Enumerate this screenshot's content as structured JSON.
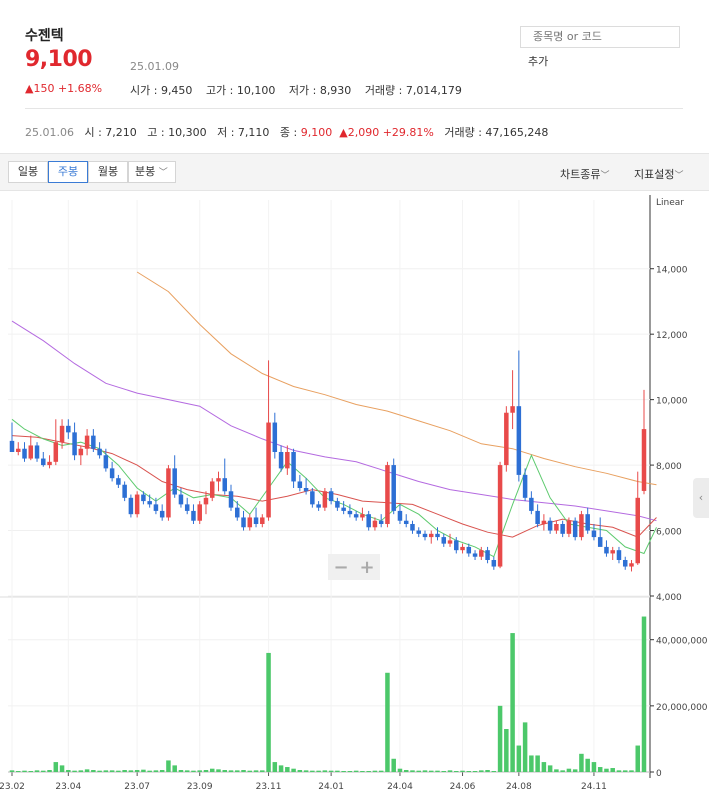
{
  "header": {
    "name": "수젠텍",
    "price": "9,100",
    "date": "25.01.09",
    "change": "▲150 +1.68%",
    "open": "시가 : 9,450",
    "high": "고가 : 10,100",
    "low": "저가 : 8,930",
    "volume": "거래량 : 7,014,179"
  },
  "search": {
    "placeholder": "종목명 or 코드",
    "add_label": "추가"
  },
  "prev": {
    "date": "25.01.06",
    "open": "시 : 7,210",
    "high": "고 : 10,300",
    "low": "저 : 7,110",
    "close_label": "종 : ",
    "close": "9,100",
    "change": "▲2,090 +29.81%",
    "volume": "거래량 : 47,165,248"
  },
  "toolbar": {
    "tabs": [
      "일봉",
      "주봉",
      "월봉",
      "분봉"
    ],
    "active": "주봉",
    "chart_type": "차트종류",
    "indicators": "지표설정"
  },
  "zoom": {
    "minus": "−",
    "plus": "+"
  },
  "colors": {
    "up": "#e84a4a",
    "down": "#2d6fd4",
    "volume": "#4cc86a",
    "ma5": "#5dca6e",
    "ma20": "#d9534f",
    "ma60": "#b46ae0",
    "ma120": "#e8a060"
  },
  "chart_data": {
    "type": "candlestick",
    "scale_label": "Linear",
    "price_ticks": [
      "14,000",
      "12,000",
      "10,000",
      "8,000",
      "6,000",
      "4,000"
    ],
    "price_tick_values": [
      14000,
      12000,
      10000,
      8000,
      6000,
      4000
    ],
    "volume_ticks": [
      "40,000,000",
      "20,000,000",
      "0"
    ],
    "volume_tick_values": [
      40000000,
      20000000,
      0
    ],
    "x_ticks": [
      "23.02",
      "23.04",
      "23.07",
      "23.09",
      "23.11",
      "24.01",
      "24.04",
      "24.06",
      "24.08",
      "24.11"
    ],
    "x_tick_index": [
      0,
      9,
      20,
      30,
      41,
      51,
      62,
      72,
      81,
      93
    ],
    "ohlc": [
      [
        8740,
        9300,
        8400,
        8400
      ],
      [
        8400,
        8700,
        8300,
        8500
      ],
      [
        8500,
        8700,
        8100,
        8200
      ],
      [
        8200,
        8900,
        8150,
        8600
      ],
      [
        8600,
        8700,
        8100,
        8200
      ],
      [
        8200,
        8400,
        7950,
        8000
      ],
      [
        8000,
        8300,
        7900,
        8100
      ],
      [
        8100,
        9400,
        8000,
        8700
      ],
      [
        8700,
        9400,
        8500,
        9200
      ],
      [
        9200,
        9400,
        8800,
        9000
      ],
      [
        9000,
        9300,
        8150,
        8300
      ],
      [
        8300,
        8600,
        8000,
        8500
      ],
      [
        8500,
        9100,
        8300,
        8900
      ],
      [
        8900,
        9100,
        8400,
        8500
      ],
      [
        8500,
        8700,
        8200,
        8300
      ],
      [
        8300,
        8500,
        7800,
        7900
      ],
      [
        7900,
        8100,
        7500,
        7600
      ],
      [
        7600,
        7700,
        7300,
        7400
      ],
      [
        7400,
        7500,
        6900,
        7000
      ],
      [
        7000,
        7100,
        6400,
        6500
      ],
      [
        6500,
        7200,
        6400,
        7100
      ],
      [
        7100,
        7200,
        6800,
        6900
      ],
      [
        6900,
        7100,
        6700,
        6800
      ],
      [
        6800,
        7000,
        6500,
        6600
      ],
      [
        6600,
        6800,
        6300,
        6400
      ],
      [
        6400,
        8000,
        6300,
        7900
      ],
      [
        7900,
        8300,
        7000,
        7100
      ],
      [
        7100,
        7300,
        6700,
        6800
      ],
      [
        6800,
        7000,
        6500,
        6600
      ],
      [
        6600,
        6800,
        6200,
        6300
      ],
      [
        6300,
        6900,
        6200,
        6800
      ],
      [
        6800,
        7200,
        6500,
        7000
      ],
      [
        7000,
        7600,
        6900,
        7500
      ],
      [
        7500,
        7800,
        7200,
        7600
      ],
      [
        7600,
        8200,
        7100,
        7200
      ],
      [
        7200,
        7400,
        6600,
        6700
      ],
      [
        6700,
        6900,
        6300,
        6400
      ],
      [
        6400,
        6600,
        6000,
        6100
      ],
      [
        6100,
        6500,
        6000,
        6400
      ],
      [
        6400,
        6700,
        6100,
        6200
      ],
      [
        6200,
        6500,
        6100,
        6400
      ],
      [
        6400,
        11200,
        6300,
        9300
      ],
      [
        9300,
        9600,
        8200,
        8400
      ],
      [
        8400,
        8600,
        7800,
        7900
      ],
      [
        7900,
        8600,
        7700,
        8400
      ],
      [
        8400,
        8500,
        7300,
        7500
      ],
      [
        7500,
        7700,
        7200,
        7300
      ],
      [
        7300,
        7600,
        7100,
        7200
      ],
      [
        7200,
        7300,
        6700,
        6800
      ],
      [
        6800,
        6900,
        6600,
        6700
      ],
      [
        6700,
        7300,
        6600,
        7200
      ],
      [
        7200,
        7300,
        6800,
        6900
      ],
      [
        6900,
        7000,
        6600,
        6700
      ],
      [
        6700,
        6900,
        6500,
        6600
      ],
      [
        6600,
        6800,
        6400,
        6500
      ],
      [
        6500,
        6600,
        6300,
        6400
      ],
      [
        6400,
        6700,
        6300,
        6500
      ],
      [
        6500,
        6600,
        6000,
        6100
      ],
      [
        6100,
        6400,
        6000,
        6300
      ],
      [
        6300,
        6500,
        6100,
        6200
      ],
      [
        6200,
        8100,
        6100,
        8000
      ],
      [
        8000,
        8200,
        6500,
        6600
      ],
      [
        6600,
        6800,
        6200,
        6300
      ],
      [
        6300,
        6500,
        6100,
        6200
      ],
      [
        6200,
        6300,
        5900,
        6000
      ],
      [
        6000,
        6100,
        5800,
        5900
      ],
      [
        5900,
        6000,
        5700,
        5800
      ],
      [
        5800,
        6000,
        5600,
        5900
      ],
      [
        5900,
        6100,
        5700,
        5800
      ],
      [
        5800,
        5900,
        5500,
        5600
      ],
      [
        5600,
        5900,
        5500,
        5700
      ],
      [
        5700,
        5800,
        5300,
        5400
      ],
      [
        5400,
        5600,
        5300,
        5500
      ],
      [
        5500,
        5600,
        5200,
        5300
      ],
      [
        5300,
        5400,
        5100,
        5200
      ],
      [
        5200,
        5500,
        5100,
        5400
      ],
      [
        5400,
        5500,
        5000,
        5100
      ],
      [
        5100,
        5200,
        4800,
        4900
      ],
      [
        4900,
        8100,
        4850,
        8000
      ],
      [
        8000,
        9800,
        7800,
        9600
      ],
      [
        9600,
        10900,
        9100,
        9800
      ],
      [
        9800,
        11500,
        7500,
        7700
      ],
      [
        7700,
        7900,
        6900,
        7000
      ],
      [
        7000,
        7200,
        6500,
        6600
      ],
      [
        6600,
        6800,
        6100,
        6200
      ],
      [
        6200,
        6500,
        6000,
        6300
      ],
      [
        6300,
        6400,
        5900,
        6000
      ],
      [
        6000,
        6300,
        5900,
        6200
      ],
      [
        6200,
        6300,
        5800,
        5900
      ],
      [
        5900,
        6400,
        5800,
        6300
      ],
      [
        6300,
        6400,
        5700,
        5800
      ],
      [
        5800,
        6600,
        5700,
        6500
      ],
      [
        6500,
        6700,
        5900,
        6000
      ],
      [
        6000,
        6200,
        5700,
        5800
      ],
      [
        5800,
        6400,
        5600,
        5500
      ],
      [
        5500,
        5700,
        5200,
        5300
      ],
      [
        5300,
        5500,
        5100,
        5400
      ],
      [
        5400,
        5500,
        5000,
        5100
      ],
      [
        5100,
        5200,
        4800,
        4900
      ],
      [
        4900,
        5100,
        4750,
        5000
      ],
      [
        5000,
        7800,
        4950,
        7000
      ],
      [
        7210,
        10300,
        7110,
        9100
      ]
    ],
    "volume": [
      0.5,
      0.3,
      0.4,
      0.3,
      0.5,
      0.4,
      0.6,
      3,
      2,
      0.6,
      0.4,
      0.5,
      0.8,
      0.6,
      0.4,
      0.5,
      0.5,
      0.4,
      0.6,
      0.5,
      0.6,
      0.7,
      0.4,
      0.5,
      0.6,
      3.5,
      2,
      0.6,
      0.5,
      0.4,
      0.5,
      0.6,
      1,
      0.8,
      0.6,
      0.5,
      0.5,
      0.6,
      0.4,
      0.5,
      0.5,
      36,
      3,
      2,
      1.5,
      1,
      0.6,
      0.5,
      0.4,
      0.4,
      0.5,
      0.4,
      0.4,
      0.3,
      0.3,
      0.4,
      0.3,
      0.3,
      0.4,
      0.4,
      30,
      4,
      1,
      0.6,
      0.5,
      0.4,
      0.5,
      0.4,
      0.4,
      0.3,
      0.5,
      0.3,
      0.4,
      0.3,
      0.3,
      0.5,
      0.6,
      0.3,
      20,
      13,
      42,
      8,
      15,
      5,
      5,
      3,
      2,
      0.8,
      0.5,
      1,
      0.8,
      5.5,
      4,
      3,
      1.5,
      1,
      1.2,
      0.5,
      0.5,
      0.5,
      8,
      47
    ],
    "ma5": [
      [
        0,
        9400
      ],
      [
        2,
        9100
      ],
      [
        5,
        8800
      ],
      [
        8,
        8600
      ],
      [
        11,
        8700
      ],
      [
        14,
        8500
      ],
      [
        17,
        8000
      ],
      [
        20,
        7300
      ],
      [
        23,
        6900
      ],
      [
        26,
        7300
      ],
      [
        29,
        7000
      ],
      [
        32,
        7100
      ],
      [
        35,
        7000
      ],
      [
        38,
        6500
      ],
      [
        41,
        7300
      ],
      [
        44,
        8100
      ],
      [
        47,
        7600
      ],
      [
        50,
        7000
      ],
      [
        53,
        6800
      ],
      [
        56,
        6500
      ],
      [
        59,
        6300
      ],
      [
        62,
        6800
      ],
      [
        65,
        6500
      ],
      [
        68,
        6000
      ],
      [
        71,
        5700
      ],
      [
        74,
        5500
      ],
      [
        77,
        5200
      ],
      [
        80,
        6800
      ],
      [
        83,
        8300
      ],
      [
        86,
        7000
      ],
      [
        89,
        6200
      ],
      [
        92,
        6100
      ],
      [
        95,
        6000
      ],
      [
        98,
        5500
      ],
      [
        101,
        5300
      ],
      [
        103,
        6100
      ]
    ],
    "ma20": [
      [
        0,
        8900
      ],
      [
        4,
        8850
      ],
      [
        8,
        8700
      ],
      [
        12,
        8550
      ],
      [
        16,
        8350
      ],
      [
        20,
        8000
      ],
      [
        24,
        7500
      ],
      [
        28,
        7250
      ],
      [
        32,
        7100
      ],
      [
        36,
        7050
      ],
      [
        40,
        6900
      ],
      [
        44,
        7050
      ],
      [
        48,
        7250
      ],
      [
        52,
        7100
      ],
      [
        56,
        6900
      ],
      [
        60,
        6850
      ],
      [
        64,
        6800
      ],
      [
        68,
        6500
      ],
      [
        72,
        6200
      ],
      [
        76,
        5950
      ],
      [
        80,
        5800
      ],
      [
        84,
        6150
      ],
      [
        88,
        6350
      ],
      [
        92,
        6200
      ],
      [
        96,
        6100
      ],
      [
        100,
        5800
      ],
      [
        103,
        6400
      ]
    ],
    "ma60": [
      [
        0,
        12400
      ],
      [
        5,
        11800
      ],
      [
        10,
        11100
      ],
      [
        15,
        10500
      ],
      [
        20,
        10200
      ],
      [
        25,
        10000
      ],
      [
        30,
        9800
      ],
      [
        35,
        9200
      ],
      [
        40,
        8800
      ],
      [
        45,
        8450
      ],
      [
        50,
        8250
      ],
      [
        55,
        8100
      ],
      [
        60,
        7800
      ],
      [
        65,
        7500
      ],
      [
        70,
        7250
      ],
      [
        75,
        7100
      ],
      [
        80,
        6950
      ],
      [
        85,
        6850
      ],
      [
        90,
        6750
      ],
      [
        95,
        6600
      ],
      [
        100,
        6450
      ],
      [
        103,
        6300
      ]
    ],
    "ma120": [
      [
        20,
        13900
      ],
      [
        25,
        13300
      ],
      [
        30,
        12300
      ],
      [
        35,
        11400
      ],
      [
        40,
        10800
      ],
      [
        45,
        10400
      ],
      [
        50,
        10150
      ],
      [
        55,
        9850
      ],
      [
        60,
        9650
      ],
      [
        65,
        9350
      ],
      [
        70,
        9050
      ],
      [
        75,
        8650
      ],
      [
        80,
        8500
      ],
      [
        85,
        8200
      ],
      [
        90,
        7950
      ],
      [
        95,
        7750
      ],
      [
        100,
        7500
      ],
      [
        103,
        7400
      ]
    ]
  }
}
